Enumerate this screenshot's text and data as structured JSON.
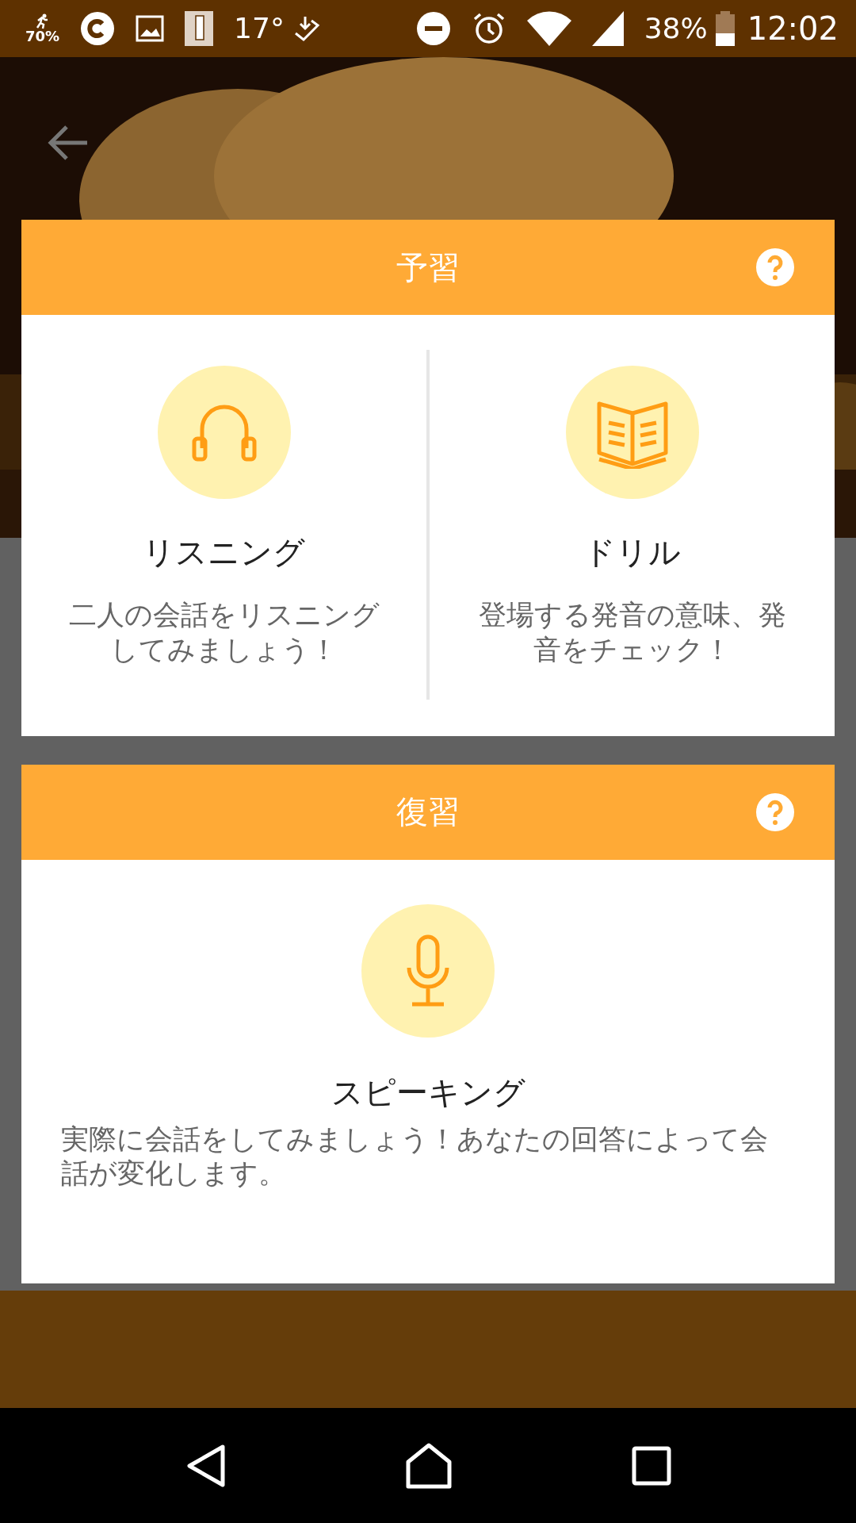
{
  "status_bar": {
    "battery_saver": "70%",
    "temperature": "17°",
    "battery": "38%",
    "time": "12:02"
  },
  "sections": [
    {
      "title": "予習",
      "items": [
        {
          "kind": "headphones",
          "title": "リスニング",
          "description": "二人の会話をリスニングしてみましょう！"
        },
        {
          "kind": "book",
          "title": "ドリル",
          "description": "登場する発音の意味、発音をチェック！"
        }
      ]
    },
    {
      "title": "復習",
      "items": [
        {
          "kind": "microphone",
          "title": "スピーキング",
          "description": "実際に会話をしてみましょう！あなたの回答によって会話が変化します。"
        }
      ]
    }
  ]
}
